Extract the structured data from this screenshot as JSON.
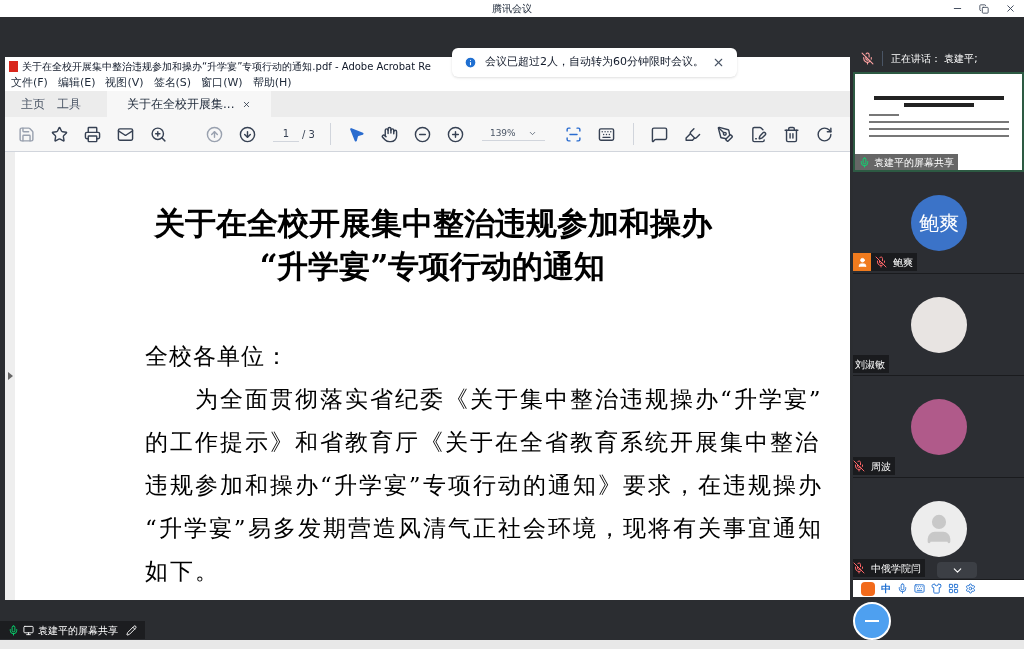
{
  "app_title": "腾讯会议",
  "notification": {
    "text": "会议已超过2人，自动转为60分钟限时会议。"
  },
  "shared_window": {
    "title": "关于在全校开展集中整治违规参加和操办“升学宴”专项行动的通知.pdf - Adobe Acrobat Re",
    "menu": [
      "文件(F)",
      "编辑(E)",
      "视图(V)",
      "签名(S)",
      "窗口(W)",
      "帮助(H)"
    ],
    "tabs": [
      {
        "label": "主页",
        "selected": false
      },
      {
        "label": "工具",
        "selected": false
      },
      {
        "label": "关于在全校开展集...",
        "selected": true
      }
    ],
    "toolbar": {
      "page": "1",
      "page_total": "/ 3",
      "zoom": "139%"
    },
    "document": {
      "title_lines": [
        "关于在全校开展集中整治违规参加和操办",
        "“升学宴”专项行动的通知"
      ],
      "salutation": "全校各单位：",
      "body_lines": [
        "为全面贯彻落实省纪委《关于集中整治违规操办“升学宴”",
        "的工作提示》和省教育厅《关于在全省教育系统开展集中整治",
        "违规参加和操办“升学宴”专项行动的通知》要求，在违规操办",
        "“升学宴”易多发期营造风清气正社会环境，现将有关事宜通知",
        "如下。"
      ]
    }
  },
  "speaker": {
    "text": "正在讲话：  袁建平;"
  },
  "thumbnail": {
    "label": "袁建平的屏幕共享"
  },
  "participants": [
    {
      "name": "鲍爽",
      "kind": "initials",
      "avatar_text": "鲍爽",
      "muted": true,
      "host": true
    },
    {
      "name": "刘淑敏",
      "kind": "photo",
      "muted": false,
      "host": false
    },
    {
      "name": "周波",
      "kind": "photo",
      "muted": true,
      "host": false
    },
    {
      "name": "中俄学院闫",
      "kind": "default",
      "muted": true,
      "host": false
    }
  ],
  "ime": {
    "mode": "中"
  },
  "share_label": "袁建平的屏幕共享"
}
